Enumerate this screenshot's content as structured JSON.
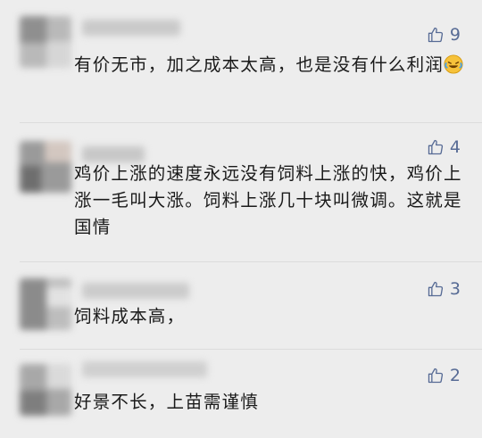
{
  "comments": [
    {
      "likes": "9",
      "text": "有价无市，加之成本太高，也是没有什么利润",
      "emoji": "laughing-crying-emoji"
    },
    {
      "likes": "4",
      "text": "鸡价上涨的速度永远没有饲料上涨的快，鸡价上涨一毛叫大涨。饲料上涨几十块叫微调。这就是国情"
    },
    {
      "likes": "3",
      "text": "饲料成本高，"
    },
    {
      "likes": "2",
      "text": "好景不长，上苗需谨慎"
    }
  ],
  "icons": {
    "like": "thumbs-up-icon"
  },
  "colors": {
    "accent": "#576b95",
    "text": "#1a1a1a",
    "background": "#ededed"
  }
}
